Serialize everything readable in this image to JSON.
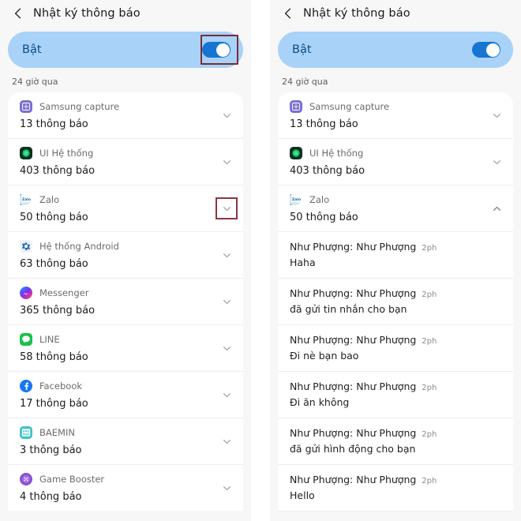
{
  "accent": {
    "switch_track": "#1675d1",
    "switch_card_bg": "#a8d2f7",
    "switch_label": "#0b4a86",
    "highlight_border": "#7d2b39",
    "page_bg": "#f7f7f7",
    "card_bg": "#ffffff"
  },
  "panels": [
    {
      "id": "left",
      "header": {
        "back_icon": "chevron-left-icon",
        "title": "Nhật ký thông báo"
      },
      "master_switch": {
        "label": "Bật",
        "state": "on",
        "highlighted": true
      },
      "section_label": "24 giờ qua",
      "apps": [
        {
          "icon": "samsung-capture-icon",
          "name": "Samsung capture",
          "count": "13 thông báo",
          "chevron": "chevron-down-icon",
          "expanded": false,
          "highlighted": false
        },
        {
          "icon": "system-ui-icon",
          "name": "UI Hệ thống",
          "count": "403 thông báo",
          "chevron": "chevron-down-icon",
          "expanded": false,
          "highlighted": false
        },
        {
          "icon": "zalo-icon",
          "name": "Zalo",
          "count": "50 thông báo",
          "chevron": "chevron-down-icon",
          "expanded": false,
          "highlighted": true
        },
        {
          "icon": "android-system-icon",
          "name": "Hệ thống Android",
          "count": "63 thông báo",
          "chevron": "chevron-down-icon",
          "expanded": false,
          "highlighted": false
        },
        {
          "icon": "messenger-icon",
          "name": "Messenger",
          "count": "365 thông báo",
          "chevron": "chevron-down-icon",
          "expanded": false,
          "highlighted": false
        },
        {
          "icon": "line-icon",
          "name": "LINE",
          "count": "58 thông báo",
          "chevron": "chevron-down-icon",
          "expanded": false,
          "highlighted": false
        },
        {
          "icon": "facebook-icon",
          "name": "Facebook",
          "count": "17 thông báo",
          "chevron": "chevron-down-icon",
          "expanded": false,
          "highlighted": false
        },
        {
          "icon": "baemin-icon",
          "name": "BAEMIN",
          "count": "3 thông báo",
          "chevron": "chevron-down-icon",
          "expanded": false,
          "highlighted": false
        },
        {
          "icon": "game-booster-icon",
          "name": "Game Booster",
          "count": "4 thông báo",
          "chevron": "chevron-down-icon",
          "expanded": false,
          "highlighted": false
        }
      ],
      "notifications": []
    },
    {
      "id": "right",
      "header": {
        "back_icon": "chevron-left-icon",
        "title": "Nhật ký thông báo"
      },
      "master_switch": {
        "label": "Bật",
        "state": "on",
        "highlighted": false
      },
      "section_label": "24 giờ qua",
      "apps": [
        {
          "icon": "samsung-capture-icon",
          "name": "Samsung capture",
          "count": "13 thông báo",
          "chevron": "chevron-down-icon",
          "expanded": false,
          "highlighted": false
        },
        {
          "icon": "system-ui-icon",
          "name": "UI Hệ thống",
          "count": "403 thông báo",
          "chevron": "chevron-down-icon",
          "expanded": false,
          "highlighted": false
        },
        {
          "icon": "zalo-icon",
          "name": "Zalo",
          "count": "50 thông báo",
          "chevron": "chevron-up-icon",
          "expanded": true,
          "highlighted": false
        }
      ],
      "notifications": [
        {
          "title": "Như Phượng: Như Phượng",
          "time": "2ph",
          "body": "Haha"
        },
        {
          "title": "Như Phượng: Như Phượng",
          "time": "2ph",
          "body": "đã gửi tin nhắn cho bạn"
        },
        {
          "title": "Như Phượng: Như Phượng",
          "time": "2ph",
          "body": "Đi nè bạn bao"
        },
        {
          "title": "Như Phượng: Như Phượng",
          "time": "2ph",
          "body": "Đi ăn không"
        },
        {
          "title": "Như Phượng: Như Phượng",
          "time": "2ph",
          "body": "đã gửi hình động cho bạn"
        },
        {
          "title": "Như Phượng: Như Phượng",
          "time": "2ph",
          "body": "Hello"
        }
      ]
    }
  ]
}
